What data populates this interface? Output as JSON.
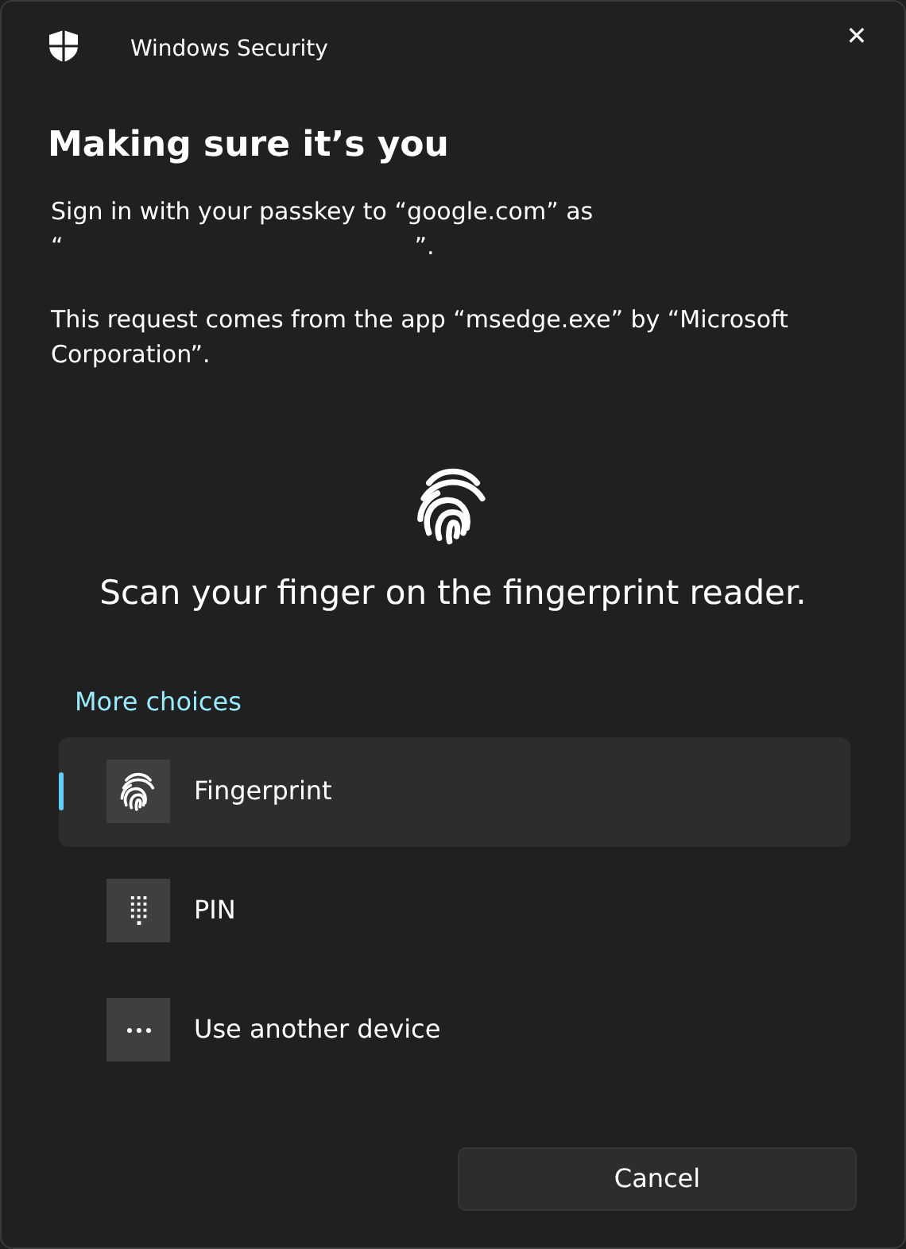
{
  "window": {
    "app_title": "Windows Security",
    "close": "✕"
  },
  "heading": "Making sure it’s you",
  "sign_in": {
    "text": "Sign in with your passkey to “google.com” as",
    "open_quote": "“",
    "close_quote": "”."
  },
  "request_text": "This request comes from the app “msedge.exe” by “Microsoft Corporation”.",
  "prompt": "Scan your finger on the fingerprint reader.",
  "more_choices": "More choices",
  "options": [
    {
      "kind": "fingerprint",
      "label": "Fingerprint",
      "selected": true
    },
    {
      "kind": "keypad",
      "label": "PIN",
      "selected": false
    },
    {
      "kind": "dots",
      "label": "Use another device",
      "selected": false
    }
  ],
  "buttons": [
    "Cancel"
  ]
}
